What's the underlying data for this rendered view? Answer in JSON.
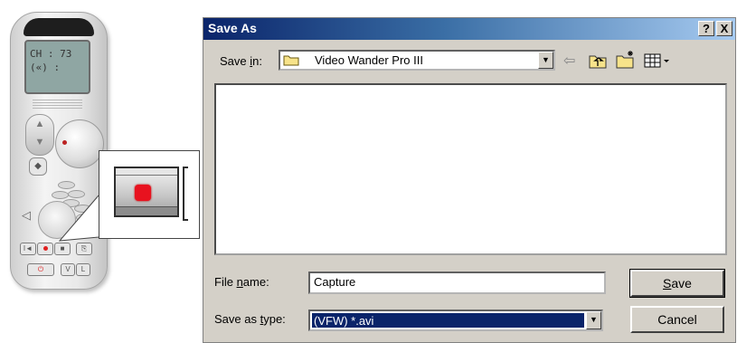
{
  "remote": {
    "lcd_line1": "CH : 73",
    "lcd_line2": "(«) :",
    "buttons": [
      "I◄",
      "●",
      "■",
      "⎘"
    ],
    "bottom_buttons": [
      "⏻",
      "V",
      "L"
    ]
  },
  "dialog": {
    "title": "Save As",
    "help_label": "?",
    "close_label": "X",
    "save_in_label_pre": "Save ",
    "save_in_label_ul": "i",
    "save_in_label_post": "n:",
    "save_in_value": "Video Wander Pro III",
    "file_name_label_pre": "File ",
    "file_name_label_ul": "n",
    "file_name_label_post": "ame:",
    "file_name_value": "Capture",
    "save_as_type_label_pre": "Save as ",
    "save_as_type_label_ul": "t",
    "save_as_type_label_post": "ype:",
    "save_as_type_value": "(VFW) *.avi",
    "save_button_ul": "S",
    "save_button_rest": "ave",
    "cancel_button": "Cancel"
  },
  "icons": [
    "folder-icon",
    "back-arrow-icon",
    "up-folder-icon",
    "new-folder-icon",
    "view-menu-icon",
    "record-icon"
  ],
  "colors": {
    "titlebar_start": "#0a246a",
    "titlebar_end": "#a6caf0",
    "dialog_bg": "#d4d0c8",
    "record_red": "#e8121f",
    "selection": "#0a246a"
  }
}
